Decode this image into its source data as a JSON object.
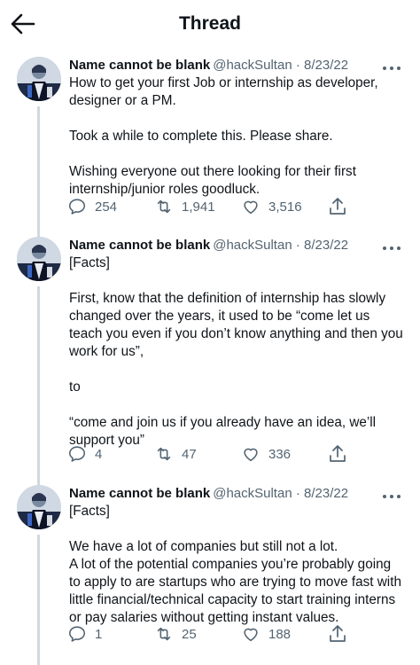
{
  "header": {
    "title": "Thread",
    "back_icon": "arrow-left-icon"
  },
  "tweets": [
    {
      "author": "Name cannot be blank",
      "handle": "@hackSultan",
      "separator": "·",
      "date": "8/23/22",
      "paragraphs": [
        "How to get your first Job or internship as developer, designer or a PM.",
        "Took a while to complete this.  Please share.",
        "Wishing everyone out there looking for their first internship/junior roles goodluck."
      ],
      "replies": "254",
      "retweets": "1,941",
      "likes": "3,516"
    },
    {
      "author": "Name cannot be blank",
      "handle": "@hackSultan",
      "separator": "·",
      "date": "8/23/22",
      "paragraphs": [
        "[Facts]",
        "First, know that the definition of internship has slowly changed over the years, it used to be “come let us teach you even if you don’t know anything and then you work for us”,",
        "to",
        "“come and join us if you already have an idea, we’ll support you”"
      ],
      "replies": "4",
      "retweets": "47",
      "likes": "336"
    },
    {
      "author": "Name cannot be blank",
      "handle": "@hackSultan",
      "separator": "·",
      "date": "8/23/22",
      "paragraphs": [
        "[Facts]",
        "We have a lot of companies but still not a lot.\nA lot of the potential companies you’re probably going to apply to are startups who are trying to move fast with little financial/technical capacity to start training interns or pay salaries without getting instant values."
      ],
      "replies": "1",
      "retweets": "25",
      "likes": "188"
    }
  ],
  "colors": {
    "text": "#0f1419",
    "secondary": "#536471",
    "thread_line": "#cfd9de"
  }
}
